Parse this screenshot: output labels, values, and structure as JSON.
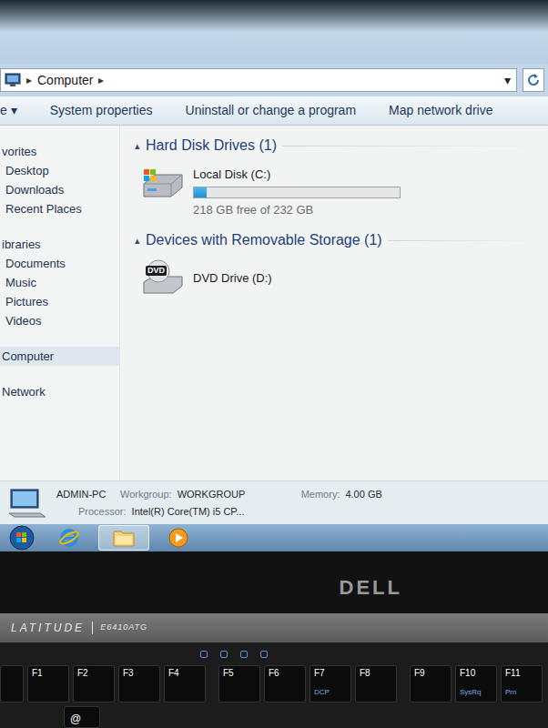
{
  "address": {
    "separator": "▸",
    "crumbs": [
      "Computer"
    ],
    "dropdown": "▾"
  },
  "toolbar": [
    {
      "label": "e ▾"
    },
    {
      "label": "System properties"
    },
    {
      "label": "Uninstall or change a program"
    },
    {
      "label": "Map network drive"
    }
  ],
  "nav": [
    {
      "label": "vorites",
      "kind": "group",
      "selected": false
    },
    {
      "label": "Desktop",
      "kind": "item",
      "selected": false
    },
    {
      "label": "Downloads",
      "kind": "item",
      "selected": false
    },
    {
      "label": "Recent Places",
      "kind": "item",
      "selected": false
    },
    {
      "label": "ibraries",
      "kind": "group",
      "selected": false
    },
    {
      "label": "Documents",
      "kind": "item",
      "selected": false
    },
    {
      "label": "Music",
      "kind": "item",
      "selected": false
    },
    {
      "label": "Pictures",
      "kind": "item",
      "selected": false
    },
    {
      "label": "Videos",
      "kind": "item",
      "selected": false
    },
    {
      "label": "Computer",
      "kind": "group",
      "selected": true
    },
    {
      "label": "Network",
      "kind": "group",
      "selected": false
    }
  ],
  "sections": [
    {
      "toggle": "▴",
      "title": "Hard Disk Drives (1)",
      "items": [
        {
          "kind": "disk",
          "name": "Local Disk (C:)",
          "level": 0.06,
          "reading": "218 GB free of 232 GB"
        }
      ]
    },
    {
      "toggle": "▴",
      "title": "Devices with Removable Storage (1)",
      "items": [
        {
          "kind": "dvd",
          "name": "DVD Drive (D:)",
          "badge": "DVD"
        }
      ]
    }
  ],
  "details": {
    "name": "ADMIN-PC",
    "workgroup_label": "Workgroup:",
    "workgroup": "WORKGROUP",
    "memory_label": "Memory:",
    "memory": "4.00 GB",
    "processor_label": "Processor:",
    "processor": "Intel(R) Core(TM) i5 CP..."
  },
  "taskbar": [
    {
      "kind": "start",
      "selected": false
    },
    {
      "kind": "ie",
      "selected": false
    },
    {
      "kind": "explorer",
      "selected": true
    },
    {
      "kind": "media",
      "selected": false
    }
  ],
  "laptop": {
    "brand": "DELL",
    "series": "LATITUDE",
    "model": "E6410ATG"
  },
  "keys": [
    {
      "label": "F1"
    },
    {
      "label": "F2"
    },
    {
      "label": "F3"
    },
    {
      "label": "F4"
    },
    {
      "label": "F5"
    },
    {
      "label": "F6"
    },
    {
      "label": "F7",
      "sub": "DCP"
    },
    {
      "label": "F8"
    },
    {
      "label": "F9"
    },
    {
      "label": "F10",
      "sub": "SysRq"
    },
    {
      "label": "F11",
      "sub": "Prn"
    }
  ],
  "bottom_keys": [
    "@"
  ]
}
